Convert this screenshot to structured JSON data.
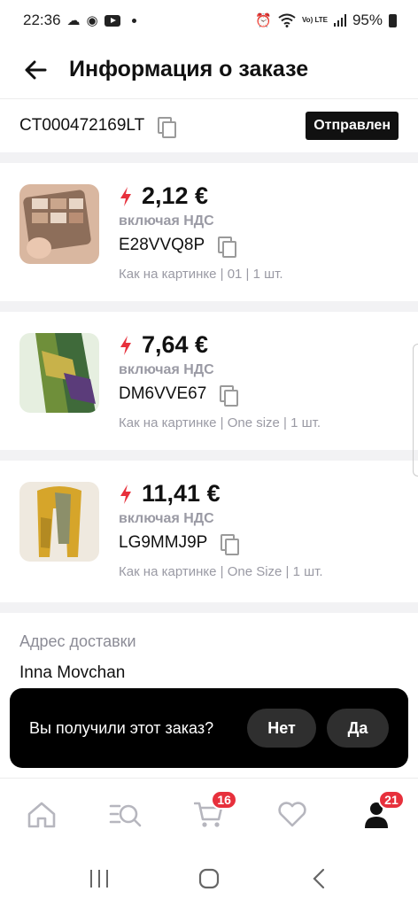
{
  "status_bar": {
    "time": "22:36",
    "battery": "95%",
    "volte": "Vo) LTE"
  },
  "header": {
    "title": "Информация о заказе"
  },
  "order": {
    "number": "CT000472169LT",
    "status": "Отправлен"
  },
  "products": [
    {
      "price": "2,12 €",
      "vat": "включая НДС",
      "sku": "E28VVQ8P",
      "variant": "Как на картинке | 01 | 1 шт.",
      "thumb_colors": [
        "#c9a58a",
        "#8d6e5a",
        "#e8d6c6"
      ]
    },
    {
      "price": "7,64 €",
      "vat": "включая НДС",
      "sku": "DM6VVE67",
      "variant": "Как на картинке | One size | 1 шт.",
      "thumb_colors": [
        "#6f8f3a",
        "#3f6a3a",
        "#c8b24a"
      ]
    },
    {
      "price": "11,41 €",
      "vat": "включая НДС",
      "sku": "LG9MMJ9P",
      "variant": "Как на картинке | One Size | 1 шт.",
      "thumb_colors": [
        "#d6a52a",
        "#8c8f6a",
        "#efe9df"
      ]
    }
  ],
  "address": {
    "label": "Адрес доставки",
    "name": "Inna Movchan"
  },
  "toast": {
    "question": "Вы получили этот заказ?",
    "no_label": "Нет",
    "yes_label": "Да"
  },
  "tabs": {
    "cart_badge": "16",
    "account_badge": "21"
  },
  "colors": {
    "accent_red": "#e7303c",
    "muted_text": "#9a9aa4",
    "badge_bg": "#111111"
  },
  "icons": {
    "back": "arrow-left-icon",
    "copy": "copy-icon",
    "bolt": "lightning-icon",
    "home": "home-icon",
    "catalog": "catalog-search-icon",
    "cart": "cart-icon",
    "wishlist": "heart-icon",
    "account": "user-icon"
  }
}
